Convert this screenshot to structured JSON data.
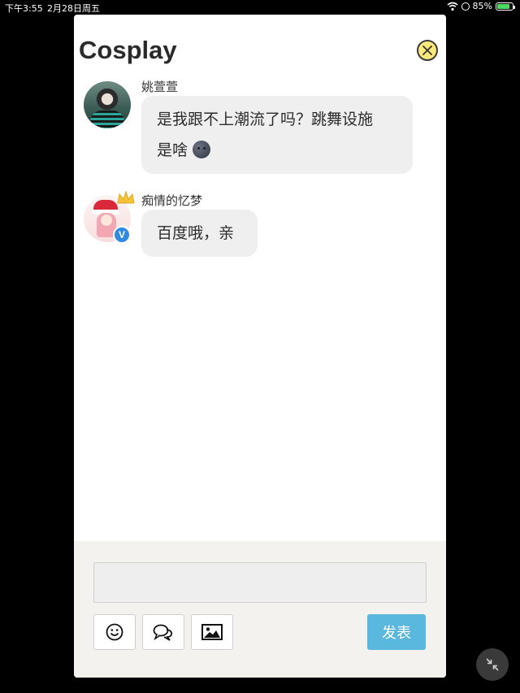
{
  "status_bar": {
    "time": "下午3:55",
    "date": "2月28日周五",
    "battery": "85%",
    "battery_level": 0.85
  },
  "panel": {
    "title": "Cosplay",
    "close_icon": "close-circle-icon"
  },
  "messages": [
    {
      "username": "姚萱萱",
      "text_line1": "是我跟不上潮流了吗？跳舞设施",
      "text_line2": "是啥",
      "emoji": "new-moon-face-emoji"
    },
    {
      "username": "痴情的忆梦",
      "text": "百度哦，亲",
      "badge": "V"
    }
  ],
  "composer": {
    "input_value": "",
    "tools": [
      "smiley-icon",
      "chat-bubbles-icon",
      "image-icon"
    ],
    "send_label": "发表"
  },
  "colors": {
    "send_button": "#5ab7de",
    "close_button": "#fbe97b",
    "bubble": "#efefef",
    "composer_bg": "#f3f2ee",
    "verified": "#2f8ae0"
  }
}
